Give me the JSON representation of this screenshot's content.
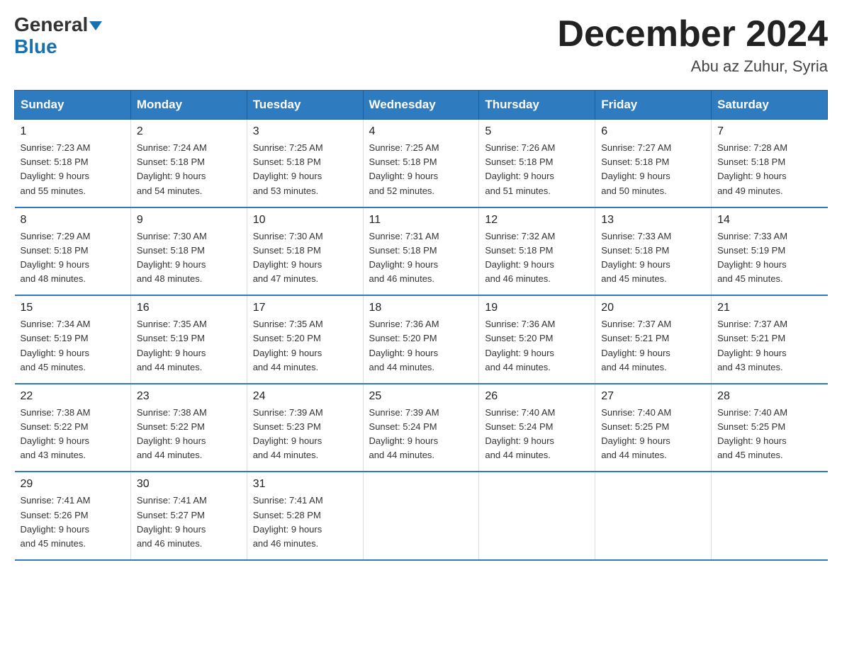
{
  "header": {
    "logo_general": "General",
    "logo_blue": "Blue",
    "month_title": "December 2024",
    "location": "Abu az Zuhur, Syria"
  },
  "days_of_week": [
    "Sunday",
    "Monday",
    "Tuesday",
    "Wednesday",
    "Thursday",
    "Friday",
    "Saturday"
  ],
  "weeks": [
    [
      {
        "day": "1",
        "sunrise": "7:23 AM",
        "sunset": "5:18 PM",
        "daylight": "9 hours and 55 minutes."
      },
      {
        "day": "2",
        "sunrise": "7:24 AM",
        "sunset": "5:18 PM",
        "daylight": "9 hours and 54 minutes."
      },
      {
        "day": "3",
        "sunrise": "7:25 AM",
        "sunset": "5:18 PM",
        "daylight": "9 hours and 53 minutes."
      },
      {
        "day": "4",
        "sunrise": "7:25 AM",
        "sunset": "5:18 PM",
        "daylight": "9 hours and 52 minutes."
      },
      {
        "day": "5",
        "sunrise": "7:26 AM",
        "sunset": "5:18 PM",
        "daylight": "9 hours and 51 minutes."
      },
      {
        "day": "6",
        "sunrise": "7:27 AM",
        "sunset": "5:18 PM",
        "daylight": "9 hours and 50 minutes."
      },
      {
        "day": "7",
        "sunrise": "7:28 AM",
        "sunset": "5:18 PM",
        "daylight": "9 hours and 49 minutes."
      }
    ],
    [
      {
        "day": "8",
        "sunrise": "7:29 AM",
        "sunset": "5:18 PM",
        "daylight": "9 hours and 48 minutes."
      },
      {
        "day": "9",
        "sunrise": "7:30 AM",
        "sunset": "5:18 PM",
        "daylight": "9 hours and 48 minutes."
      },
      {
        "day": "10",
        "sunrise": "7:30 AM",
        "sunset": "5:18 PM",
        "daylight": "9 hours and 47 minutes."
      },
      {
        "day": "11",
        "sunrise": "7:31 AM",
        "sunset": "5:18 PM",
        "daylight": "9 hours and 46 minutes."
      },
      {
        "day": "12",
        "sunrise": "7:32 AM",
        "sunset": "5:18 PM",
        "daylight": "9 hours and 46 minutes."
      },
      {
        "day": "13",
        "sunrise": "7:33 AM",
        "sunset": "5:18 PM",
        "daylight": "9 hours and 45 minutes."
      },
      {
        "day": "14",
        "sunrise": "7:33 AM",
        "sunset": "5:19 PM",
        "daylight": "9 hours and 45 minutes."
      }
    ],
    [
      {
        "day": "15",
        "sunrise": "7:34 AM",
        "sunset": "5:19 PM",
        "daylight": "9 hours and 45 minutes."
      },
      {
        "day": "16",
        "sunrise": "7:35 AM",
        "sunset": "5:19 PM",
        "daylight": "9 hours and 44 minutes."
      },
      {
        "day": "17",
        "sunrise": "7:35 AM",
        "sunset": "5:20 PM",
        "daylight": "9 hours and 44 minutes."
      },
      {
        "day": "18",
        "sunrise": "7:36 AM",
        "sunset": "5:20 PM",
        "daylight": "9 hours and 44 minutes."
      },
      {
        "day": "19",
        "sunrise": "7:36 AM",
        "sunset": "5:20 PM",
        "daylight": "9 hours and 44 minutes."
      },
      {
        "day": "20",
        "sunrise": "7:37 AM",
        "sunset": "5:21 PM",
        "daylight": "9 hours and 44 minutes."
      },
      {
        "day": "21",
        "sunrise": "7:37 AM",
        "sunset": "5:21 PM",
        "daylight": "9 hours and 43 minutes."
      }
    ],
    [
      {
        "day": "22",
        "sunrise": "7:38 AM",
        "sunset": "5:22 PM",
        "daylight": "9 hours and 43 minutes."
      },
      {
        "day": "23",
        "sunrise": "7:38 AM",
        "sunset": "5:22 PM",
        "daylight": "9 hours and 44 minutes."
      },
      {
        "day": "24",
        "sunrise": "7:39 AM",
        "sunset": "5:23 PM",
        "daylight": "9 hours and 44 minutes."
      },
      {
        "day": "25",
        "sunrise": "7:39 AM",
        "sunset": "5:24 PM",
        "daylight": "9 hours and 44 minutes."
      },
      {
        "day": "26",
        "sunrise": "7:40 AM",
        "sunset": "5:24 PM",
        "daylight": "9 hours and 44 minutes."
      },
      {
        "day": "27",
        "sunrise": "7:40 AM",
        "sunset": "5:25 PM",
        "daylight": "9 hours and 44 minutes."
      },
      {
        "day": "28",
        "sunrise": "7:40 AM",
        "sunset": "5:25 PM",
        "daylight": "9 hours and 45 minutes."
      }
    ],
    [
      {
        "day": "29",
        "sunrise": "7:41 AM",
        "sunset": "5:26 PM",
        "daylight": "9 hours and 45 minutes."
      },
      {
        "day": "30",
        "sunrise": "7:41 AM",
        "sunset": "5:27 PM",
        "daylight": "9 hours and 46 minutes."
      },
      {
        "day": "31",
        "sunrise": "7:41 AM",
        "sunset": "5:28 PM",
        "daylight": "9 hours and 46 minutes."
      },
      null,
      null,
      null,
      null
    ]
  ],
  "labels": {
    "sunrise_prefix": "Sunrise: ",
    "sunset_prefix": "Sunset: ",
    "daylight_prefix": "Daylight: "
  }
}
